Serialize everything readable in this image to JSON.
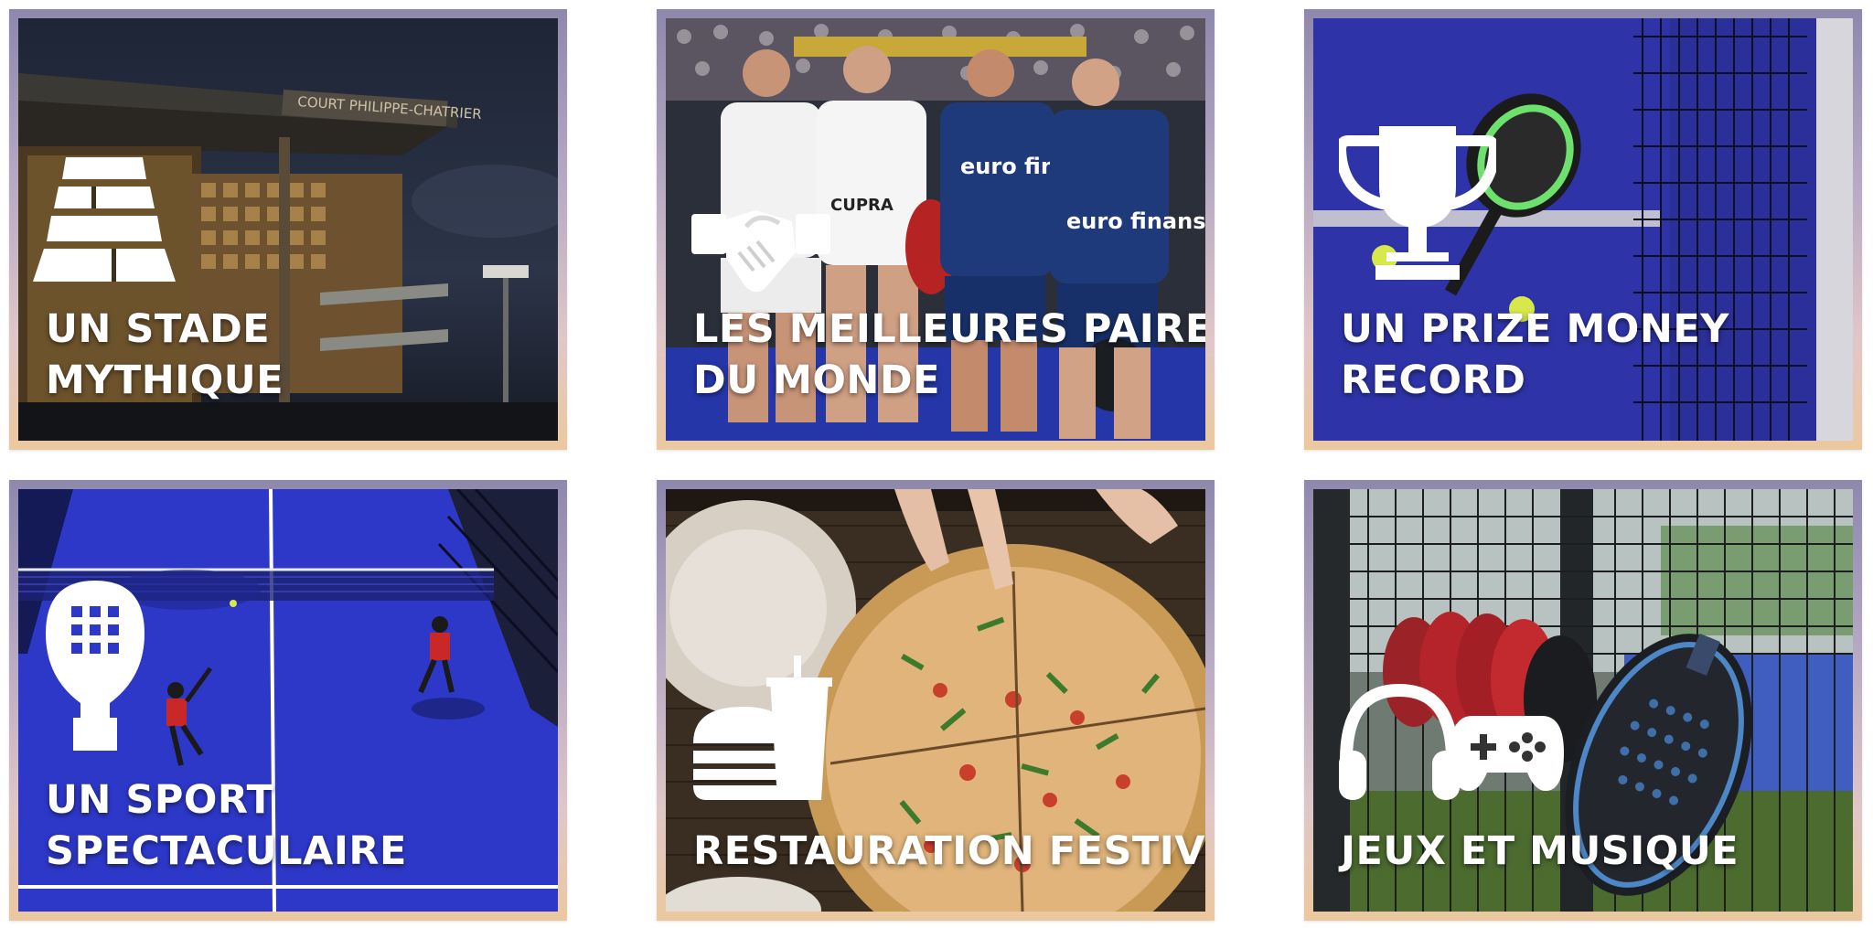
{
  "cards": [
    {
      "title_line1": "UN STADE",
      "title_line2": "MYTHIQUE",
      "sign": "COURT PHILIPPE-CHATRIER",
      "icon": "stadium-icon"
    },
    {
      "title_line1": "LES MEILLEURES PAIRES",
      "title_line2": "DU MONDE",
      "jersey1": "euro finans",
      "jersey2": "euro finans",
      "shirt": "CUPRA",
      "icon": "handshake-icon"
    },
    {
      "title_line1": "UN PRIZE MONEY",
      "title_line2": "RECORD",
      "icon": "trophy-icon"
    },
    {
      "title_line1": "UN SPORT",
      "title_line2": "SPECTACULAIRE",
      "icon": "padel-racket-icon"
    },
    {
      "title_line1": "RESTAURATION FESTIVE",
      "icon": "burger-drink-icon"
    },
    {
      "title_line1": "JEUX ET MUSIQUE",
      "icon": "headphones-gamepad-icon"
    }
  ],
  "colors": {
    "caption": "#ffffff",
    "padel_blue": "#2d38c9",
    "frame_top": "#8e88ad",
    "frame_bottom": "#ecc89e"
  }
}
